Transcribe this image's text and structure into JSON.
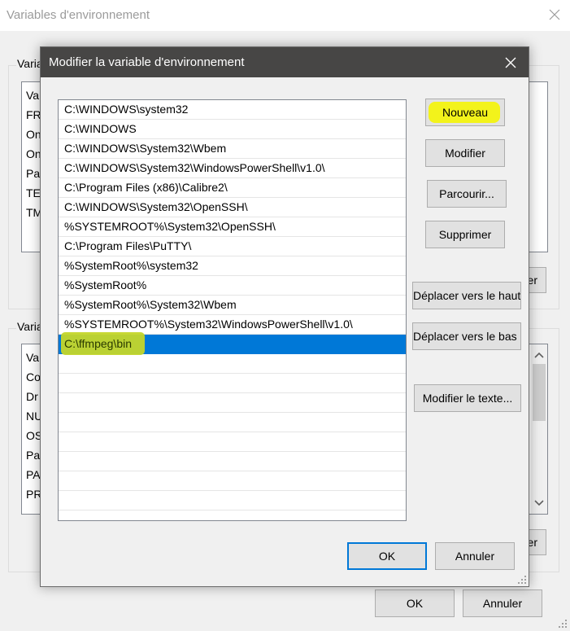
{
  "back_window": {
    "title": "Variables d'environnement",
    "user_group_label": "Varia",
    "user_list_header": "Va",
    "user_list_rows": [
      "FR",
      "On",
      "On",
      "Pa",
      "TE",
      "TM"
    ],
    "user_edit_button_partial": "er",
    "system_group_label": "Varia",
    "system_list_header": "Va",
    "system_list_rows": [
      "Co",
      "Dr",
      "NU",
      "OS",
      "Pa",
      "PA",
      "PR"
    ],
    "system_edit_button_partial": "er",
    "ok_label": "OK",
    "cancel_label": "Annuler"
  },
  "dialog": {
    "title": "Modifier la variable d'environnement",
    "paths": [
      "C:\\WINDOWS\\system32",
      "C:\\WINDOWS",
      "C:\\WINDOWS\\System32\\Wbem",
      "C:\\WINDOWS\\System32\\WindowsPowerShell\\v1.0\\",
      "C:\\Program Files (x86)\\Calibre2\\",
      "C:\\WINDOWS\\System32\\OpenSSH\\",
      "%SYSTEMROOT%\\System32\\OpenSSH\\",
      "C:\\Program Files\\PuTTY\\",
      "%SystemRoot%\\system32",
      "%SystemRoot%",
      "%SystemRoot%\\System32\\Wbem",
      "%SYSTEMROOT%\\System32\\WindowsPowerShell\\v1.0\\",
      "C:\\ffmpeg\\bin"
    ],
    "selected_index": 12,
    "buttons": {
      "new": "Nouveau",
      "edit": "Modifier",
      "browse": "Parcourir...",
      "delete": "Supprimer",
      "move_up": "Déplacer vers le haut",
      "move_down": "Déplacer vers le bas",
      "edit_text": "Modifier le texte...",
      "ok": "OK",
      "cancel": "Annuler"
    }
  },
  "colors": {
    "selection": "#0078d7",
    "highlight_yellow": "#f3f31b",
    "selected_text_highlight": "#c4d62a",
    "dialog_titlebar": "#474645"
  }
}
